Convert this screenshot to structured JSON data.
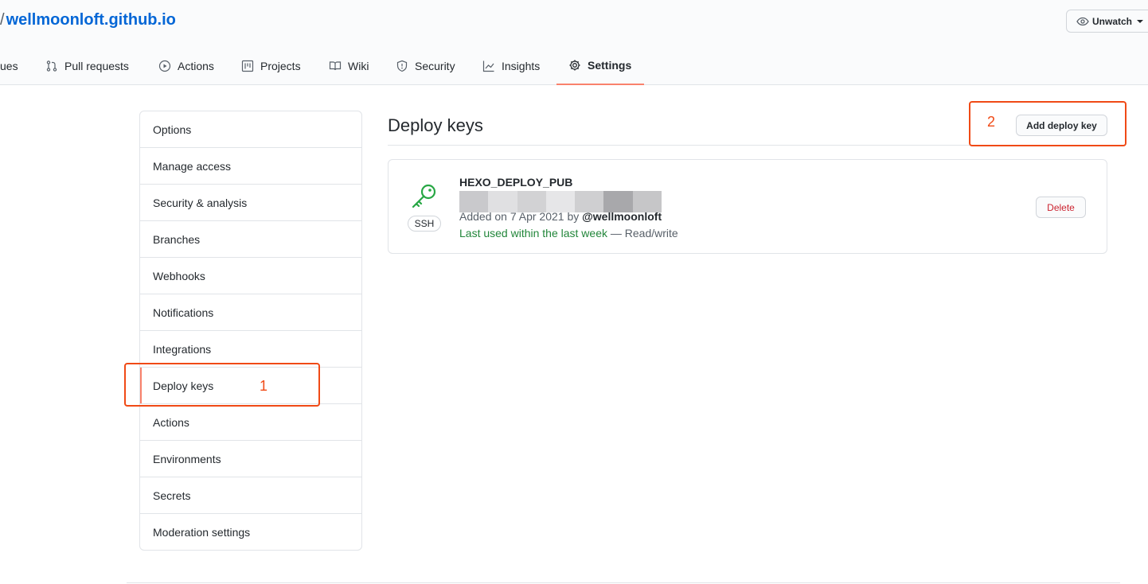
{
  "header": {
    "repo_slash": "/",
    "repo_name": "wellmoonloft.github.io",
    "unwatch_label": "Unwatch"
  },
  "tabs": [
    {
      "label": "ues",
      "icon": "issue-icon"
    },
    {
      "label": "Pull requests",
      "icon": "pull-request-icon"
    },
    {
      "label": "Actions",
      "icon": "play-icon"
    },
    {
      "label": "Projects",
      "icon": "project-icon"
    },
    {
      "label": "Wiki",
      "icon": "book-icon"
    },
    {
      "label": "Security",
      "icon": "shield-icon"
    },
    {
      "label": "Insights",
      "icon": "graph-icon"
    },
    {
      "label": "Settings",
      "icon": "gear-icon",
      "selected": true
    }
  ],
  "sidebar": {
    "items": [
      {
        "label": "Options"
      },
      {
        "label": "Manage access"
      },
      {
        "label": "Security & analysis"
      },
      {
        "label": "Branches"
      },
      {
        "label": "Webhooks"
      },
      {
        "label": "Notifications"
      },
      {
        "label": "Integrations"
      },
      {
        "label": "Deploy keys",
        "active": true
      },
      {
        "label": "Actions"
      },
      {
        "label": "Environments"
      },
      {
        "label": "Secrets"
      },
      {
        "label": "Moderation settings"
      }
    ]
  },
  "main": {
    "title": "Deploy keys",
    "add_button_label": "Add deploy key",
    "key": {
      "name": "HEXO_DEPLOY_PUB",
      "type_badge": "SSH",
      "added_prefix": "Added on 7 Apr 2021 by ",
      "added_by": "@wellmoonloft",
      "last_used": "Last used within the last week",
      "access": " — Read/write",
      "delete_label": "Delete"
    }
  },
  "annotations": {
    "marker_1": "1",
    "marker_2": "2",
    "color": "#f04a16"
  },
  "colors": {
    "link": "#0366d6",
    "selected_tab_underline": "#f9826c",
    "danger": "#cb2431",
    "success": "#22863a"
  }
}
